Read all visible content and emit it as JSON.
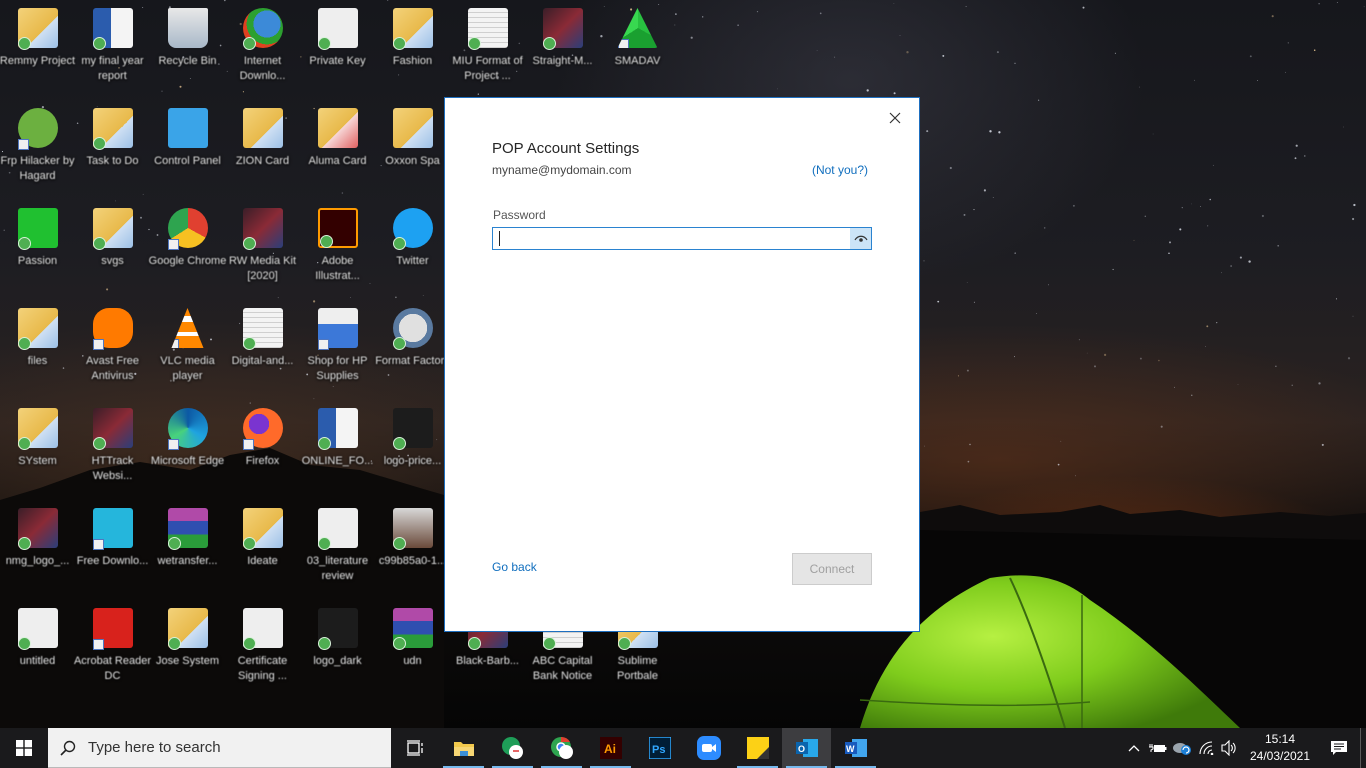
{
  "desktop": {
    "icons": [
      {
        "label": "Remmy Project",
        "type": "folder",
        "badge": "check"
      },
      {
        "label": "my final year report",
        "type": "word",
        "badge": "check"
      },
      {
        "label": "Recycle Bin",
        "type": "recycle",
        "badge": "none"
      },
      {
        "label": "Internet Downlo...",
        "type": "idm",
        "badge": "check"
      },
      {
        "label": "Private Key",
        "type": "file",
        "badge": "check"
      },
      {
        "label": "Fashion",
        "type": "folder",
        "badge": "check"
      },
      {
        "label": "MIU Format of Project ...",
        "type": "document",
        "badge": "check"
      },
      {
        "label": "Straight-M...",
        "type": "image",
        "badge": "check"
      },
      {
        "label": "SMADAV",
        "type": "smadav",
        "badge": "shortcut"
      },
      {
        "label": "Frp Hilacker by Hagard",
        "type": "frp",
        "badge": "shortcut"
      },
      {
        "label": "Task to Do",
        "type": "folder",
        "badge": "check"
      },
      {
        "label": "Control Panel",
        "type": "control-panel",
        "badge": "none"
      },
      {
        "label": "ZION Card",
        "type": "folder",
        "badge": "none"
      },
      {
        "label": "Aluma Card",
        "type": "folder-pdf",
        "badge": "none"
      },
      {
        "label": "Oxxon Spa",
        "type": "folder",
        "badge": "none"
      },
      {
        "label": "Passion",
        "type": "green-file",
        "badge": "check"
      },
      {
        "label": "svgs",
        "type": "folder",
        "badge": "check"
      },
      {
        "label": "Google Chrome",
        "type": "chrome",
        "badge": "shortcut"
      },
      {
        "label": "RW Media Kit [2020]",
        "type": "image",
        "badge": "check"
      },
      {
        "label": "Adobe Illustrat...",
        "type": "illustrator",
        "badge": "check"
      },
      {
        "label": "Twitter",
        "type": "twitter",
        "badge": "check"
      },
      {
        "label": "files",
        "type": "folder",
        "badge": "check"
      },
      {
        "label": "Avast Free Antivirus",
        "type": "avast",
        "badge": "shortcut"
      },
      {
        "label": "VLC media player",
        "type": "vlc",
        "badge": "shortcut"
      },
      {
        "label": "Digital-and...",
        "type": "document",
        "badge": "check"
      },
      {
        "label": "Shop for HP Supplies",
        "type": "printer",
        "badge": "shortcut"
      },
      {
        "label": "Format Factory",
        "type": "format-factory",
        "badge": "check"
      },
      {
        "label": "SYstem",
        "type": "folder",
        "badge": "check"
      },
      {
        "label": "HTTrack Websi...",
        "type": "image",
        "badge": "check"
      },
      {
        "label": "Microsoft Edge",
        "type": "edge",
        "badge": "shortcut"
      },
      {
        "label": "Firefox",
        "type": "firefox",
        "badge": "shortcut"
      },
      {
        "label": "ONLINE_FO...",
        "type": "word",
        "badge": "check"
      },
      {
        "label": "logo-price...",
        "type": "dark-image",
        "badge": "check"
      },
      {
        "label": "nmg_logo_...",
        "type": "image",
        "badge": "check"
      },
      {
        "label": "Free Downlo...",
        "type": "free-download",
        "badge": "shortcut"
      },
      {
        "label": "wetransfer...",
        "type": "winrar",
        "badge": "check"
      },
      {
        "label": "Ideate",
        "type": "folder",
        "badge": "check"
      },
      {
        "label": "03_literature review",
        "type": "file",
        "badge": "check"
      },
      {
        "label": "c99b85a0-1...",
        "type": "photo",
        "badge": "check"
      },
      {
        "label": "untitled",
        "type": "file",
        "badge": "check"
      },
      {
        "label": "Acrobat Reader DC",
        "type": "acrobat",
        "badge": "shortcut"
      },
      {
        "label": "Jose System",
        "type": "folder",
        "badge": "check"
      },
      {
        "label": "Certificate Signing ...",
        "type": "file",
        "badge": "check"
      },
      {
        "label": "logo_dark",
        "type": "dark-image",
        "badge": "check"
      },
      {
        "label": "udn",
        "type": "winrar",
        "badge": "check"
      },
      {
        "label": "Black-Barb...",
        "type": "image",
        "badge": "check"
      },
      {
        "label": "ABC Capital Bank Notice",
        "type": "document",
        "badge": "check"
      },
      {
        "label": "Sublime Portbale",
        "type": "folder",
        "badge": "check"
      }
    ]
  },
  "dialog": {
    "title": "POP Account Settings",
    "email": "myname@mydomain.com",
    "not_you_link": "(Not you?)",
    "password_label": "Password",
    "password_value": "",
    "reveal_icon": "eye-icon",
    "go_back_link": "Go back",
    "connect_button": "Connect",
    "close_icon": "close-icon",
    "accent_color": "#106ebe"
  },
  "taskbar": {
    "search_placeholder": "Type here to search",
    "pinned_apps": [
      {
        "name": "File Explorer",
        "icon": "folder-icon",
        "running": true,
        "active": false
      },
      {
        "name": "Hangouts",
        "icon": "hangouts-icon",
        "running": true,
        "active": false
      },
      {
        "name": "Google Chrome",
        "icon": "chrome-icon",
        "running": true,
        "active": false
      },
      {
        "name": "Adobe Illustrator",
        "icon": "illustrator-icon",
        "running": true,
        "active": false
      },
      {
        "name": "Adobe Photoshop",
        "icon": "photoshop-icon",
        "running": false,
        "active": false
      },
      {
        "name": "Zoom",
        "icon": "zoom-icon",
        "running": false,
        "active": false
      },
      {
        "name": "Sticky Notes",
        "icon": "sticky-notes-icon",
        "running": true,
        "active": false
      },
      {
        "name": "Outlook",
        "icon": "outlook-icon",
        "running": true,
        "active": true
      },
      {
        "name": "Word",
        "icon": "word-icon",
        "running": true,
        "active": false
      }
    ],
    "tray": {
      "time": "15:14",
      "date": "24/03/2021",
      "icons": [
        "chevron-up-icon",
        "battery-icon",
        "onedrive-icon",
        "wifi-icon",
        "volume-icon"
      ]
    }
  }
}
